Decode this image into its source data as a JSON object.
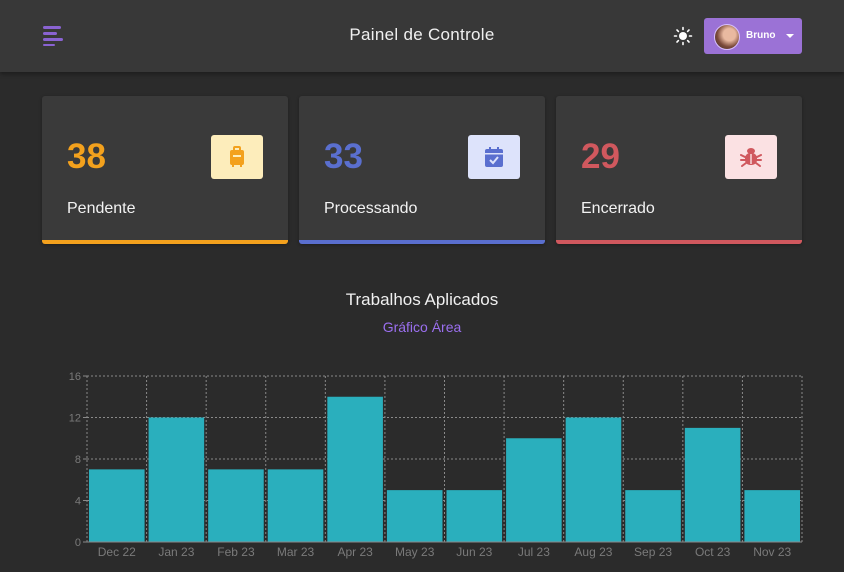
{
  "header": {
    "title": "Painel de Controle",
    "menu_icon": "menu-icon",
    "theme_icon": "sun-icon",
    "user": {
      "name": "Bruno",
      "avatar": "user-avatar"
    }
  },
  "cards": [
    {
      "value": "38",
      "label": "Pendente",
      "icon": "suitcase-icon",
      "color": "#f3a11d",
      "icon_bg": "#fdedbb"
    },
    {
      "value": "33",
      "label": "Processando",
      "icon": "calendar-check-icon",
      "color": "#5a6fcf",
      "icon_bg": "#dde3fb"
    },
    {
      "value": "29",
      "label": "Encerrado",
      "icon": "bug-icon",
      "color": "#d0585e",
      "icon_bg": "#fbe1e3"
    }
  ],
  "chart": {
    "title": "Trabalhos Aplicados",
    "subtitle": "Gráfico Área"
  },
  "chart_data": {
    "type": "bar",
    "categories": [
      "Dec 22",
      "Jan 23",
      "Feb 23",
      "Mar 23",
      "Apr 23",
      "May 23",
      "Jun 23",
      "Jul 23",
      "Aug 23",
      "Sep 23",
      "Oct 23",
      "Nov 23"
    ],
    "values": [
      7,
      12,
      7,
      7,
      14,
      5,
      5,
      10,
      12,
      5,
      11,
      5
    ],
    "title": "Trabalhos Aplicados",
    "ylim": [
      0,
      16
    ],
    "yticks": [
      0,
      4,
      8,
      12,
      16
    ],
    "grid": true,
    "bar_color": "#2aafbd"
  }
}
